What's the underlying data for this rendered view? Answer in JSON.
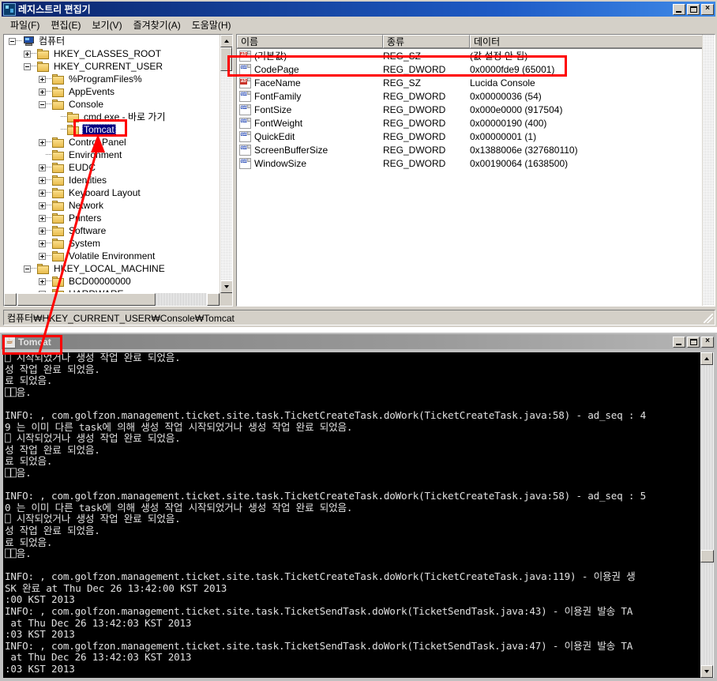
{
  "regedit": {
    "title": "레지스트리 편집기",
    "title_icon": "regedit-icon",
    "menus": [
      {
        "label": "파일(F)"
      },
      {
        "label": "편집(E)"
      },
      {
        "label": "보기(V)"
      },
      {
        "label": "즐겨찾기(A)"
      },
      {
        "label": "도움말(H)"
      }
    ],
    "window_buttons": {
      "minimize": "minimize-icon",
      "maximize": "maximize-icon",
      "close": "close-icon"
    },
    "tree": [
      {
        "label": "컴퓨터",
        "indent": 0,
        "expander": "minus",
        "icon": "computer-icon",
        "selected": false
      },
      {
        "label": "HKEY_CLASSES_ROOT",
        "indent": 1,
        "expander": "plus",
        "icon": "folder-icon",
        "selected": false
      },
      {
        "label": "HKEY_CURRENT_USER",
        "indent": 1,
        "expander": "minus",
        "icon": "folder-icon",
        "selected": false
      },
      {
        "label": "%ProgramFiles%",
        "indent": 2,
        "expander": "plus",
        "icon": "folder-icon",
        "selected": false
      },
      {
        "label": "AppEvents",
        "indent": 2,
        "expander": "plus",
        "icon": "folder-icon",
        "selected": false
      },
      {
        "label": "Console",
        "indent": 2,
        "expander": "minus",
        "icon": "folder-icon",
        "selected": false
      },
      {
        "label": "cmd.exe - 바로 가기",
        "indent": 3,
        "expander": "none",
        "icon": "folder-icon",
        "selected": false
      },
      {
        "label": "Tomcat",
        "indent": 3,
        "expander": "none",
        "icon": "folder-icon",
        "selected": true
      },
      {
        "label": "Control Panel",
        "indent": 2,
        "expander": "plus",
        "icon": "folder-icon",
        "selected": false
      },
      {
        "label": "Environment",
        "indent": 2,
        "expander": "none",
        "icon": "folder-icon",
        "selected": false
      },
      {
        "label": "EUDC",
        "indent": 2,
        "expander": "plus",
        "icon": "folder-icon",
        "selected": false
      },
      {
        "label": "Identities",
        "indent": 2,
        "expander": "plus",
        "icon": "folder-icon",
        "selected": false
      },
      {
        "label": "Keyboard Layout",
        "indent": 2,
        "expander": "plus",
        "icon": "folder-icon",
        "selected": false
      },
      {
        "label": "Network",
        "indent": 2,
        "expander": "plus",
        "icon": "folder-icon",
        "selected": false
      },
      {
        "label": "Printers",
        "indent": 2,
        "expander": "plus",
        "icon": "folder-icon",
        "selected": false
      },
      {
        "label": "Software",
        "indent": 2,
        "expander": "plus",
        "icon": "folder-icon",
        "selected": false
      },
      {
        "label": "System",
        "indent": 2,
        "expander": "plus",
        "icon": "folder-icon",
        "selected": false
      },
      {
        "label": "Volatile Environment",
        "indent": 2,
        "expander": "plus",
        "icon": "folder-icon",
        "selected": false
      },
      {
        "label": "HKEY_LOCAL_MACHINE",
        "indent": 1,
        "expander": "minus",
        "icon": "folder-icon",
        "selected": false
      },
      {
        "label": "BCD00000000",
        "indent": 2,
        "expander": "plus",
        "icon": "folder-icon",
        "selected": false
      },
      {
        "label": "HARDWARE",
        "indent": 2,
        "expander": "plus",
        "icon": "folder-icon",
        "selected": false
      }
    ],
    "list_columns": [
      {
        "label": "이름"
      },
      {
        "label": "종류"
      },
      {
        "label": "데이터"
      }
    ],
    "list_rows": [
      {
        "name": "(기본값)",
        "type": "REG_SZ",
        "data": "(값 설정 안 됨)",
        "icon": "string-value-icon"
      },
      {
        "name": "CodePage",
        "type": "REG_DWORD",
        "data": "0x0000fde9 (65001)",
        "icon": "dword-value-icon"
      },
      {
        "name": "FaceName",
        "type": "REG_SZ",
        "data": "Lucida Console",
        "icon": "string-value-icon"
      },
      {
        "name": "FontFamily",
        "type": "REG_DWORD",
        "data": "0x00000036 (54)",
        "icon": "dword-value-icon"
      },
      {
        "name": "FontSize",
        "type": "REG_DWORD",
        "data": "0x000e0000 (917504)",
        "icon": "dword-value-icon"
      },
      {
        "name": "FontWeight",
        "type": "REG_DWORD",
        "data": "0x00000190 (400)",
        "icon": "dword-value-icon"
      },
      {
        "name": "QuickEdit",
        "type": "REG_DWORD",
        "data": "0x00000001 (1)",
        "icon": "dword-value-icon"
      },
      {
        "name": "ScreenBufferSize",
        "type": "REG_DWORD",
        "data": "0x1388006e (327680110)",
        "icon": "dword-value-icon"
      },
      {
        "name": "WindowSize",
        "type": "REG_DWORD",
        "data": "0x00190064 (1638500)",
        "icon": "dword-value-icon"
      }
    ],
    "status_path": "컴퓨터₩HKEY_CURRENT_USER₩Console₩Tomcat"
  },
  "console": {
    "title": "Tomcat",
    "title_icon": "java-coffee-cup-icon",
    "window_buttons": {
      "minimize": "minimize-icon",
      "maximize": "maximize-icon",
      "close": "close-icon"
    },
    "text": "⎕ 시작되었거나 생성 작업 완료 되었음.\n성 작업 완료 되었음.\n료 되었음.\n⎕⎕음.\n\nINFO: , com.golfzon.management.ticket.site.task.TicketCreateTask.doWork(TicketCreateTask.java:58) - ad_seq : 4\n9 는 이미 다른 task에 의해 생성 작업 시작되었거나 생성 작업 완료 되었음.\n⎕ 시작되었거나 생성 작업 완료 되었음.\n성 작업 완료 되었음.\n료 되었음.\n⎕⎕음.\n\nINFO: , com.golfzon.management.ticket.site.task.TicketCreateTask.doWork(TicketCreateTask.java:58) - ad_seq : 5\n0 는 이미 다른 task에 의해 생성 작업 시작되었거나 생성 작업 완료 되었음.\n⎕ 시작되었거나 생성 작업 완료 되었음.\n성 작업 완료 되었음.\n료 되었음.\n⎕⎕음.\n\nINFO: , com.golfzon.management.ticket.site.task.TicketCreateTask.doWork(TicketCreateTask.java:119) - 이용권 생\nSK 완료 at Thu Dec 26 13:42:00 KST 2013\n:00 KST 2013\nINFO: , com.golfzon.management.ticket.site.task.TicketSendTask.doWork(TicketSendTask.java:43) - 이용권 발송 TA\n at Thu Dec 26 13:42:03 KST 2013\n:03 KST 2013\nINFO: , com.golfzon.management.ticket.site.task.TicketSendTask.doWork(TicketSendTask.java:47) - 이용권 발송 TA\n at Thu Dec 26 13:42:03 KST 2013\n:03 KST 2013"
  },
  "annotations": {
    "accent_color": "#ff0000",
    "boxes": [
      {
        "name": "tomcat-key-highlight"
      },
      {
        "name": "codepage-row-highlight"
      },
      {
        "name": "console-title-highlight"
      }
    ],
    "arrow": {
      "name": "pointer-arrow",
      "from": "console-title",
      "to": "tomcat-key"
    }
  }
}
